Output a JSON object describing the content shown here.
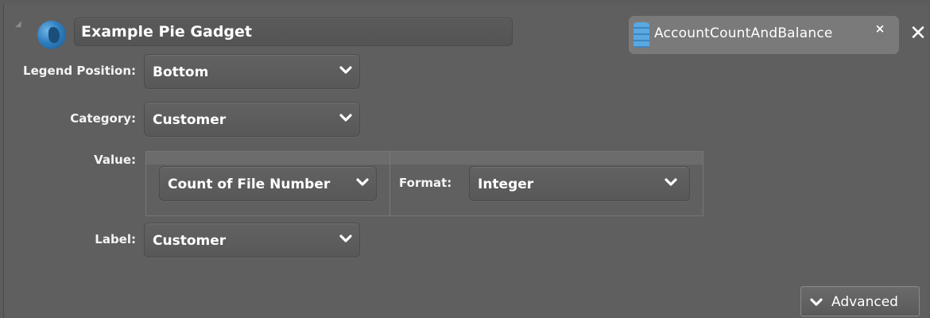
{
  "header": {
    "title": "Example Pie Gadget",
    "datasource_tab": "AccountCountAndBalance",
    "datasource_close": "×",
    "panel_close": "✕"
  },
  "form": {
    "legend_position": {
      "label": "Legend Position:",
      "value": "Bottom"
    },
    "category": {
      "label": "Category:",
      "value": "Customer"
    },
    "value": {
      "label": "Value:",
      "aggregate": "Count of File Number",
      "format_label": "Format:",
      "format_value": "Integer"
    },
    "label_field": {
      "label": "Label:",
      "value": "Customer"
    }
  },
  "actions": {
    "advanced_label": "Advanced"
  },
  "icons": {
    "gadget": "globe-icon",
    "datasource": "database-icon",
    "dropdown": "chevron-down-icon",
    "resize": "resize-grip-icon"
  }
}
